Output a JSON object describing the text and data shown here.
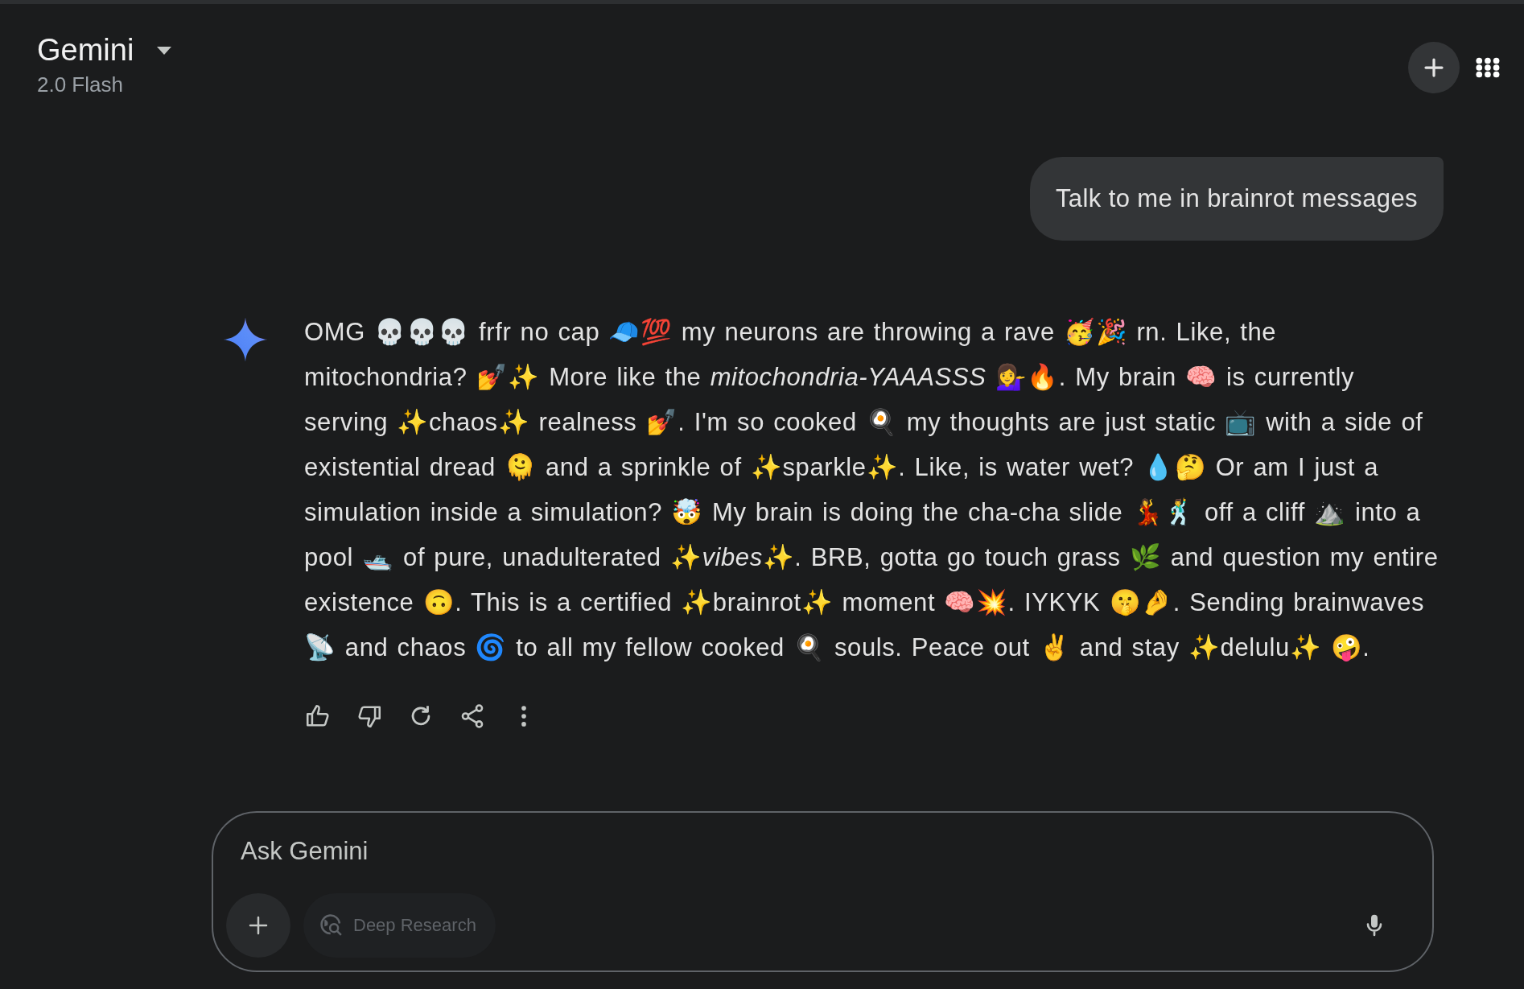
{
  "header": {
    "title": "Gemini",
    "model": "2.0 Flash"
  },
  "user_message": "Talk to me in brainrot messages",
  "response": "OMG 💀💀💀 frfr no cap 🧢💯 my neurons are throwing a rave 🥳🎉 rn. Like, the mitochondria? 💅✨ More like the *mitochondria-YAAASSS* 💁‍♀️🔥. My brain 🧠 is currently serving ✨chaos✨ realness 💅. I'm so cooked 🍳 my thoughts are just static 📺 with a side of existential dread 🫠 and a sprinkle of ✨sparkle✨.  Like, is water wet? 💧🤔 Or am I just a simulation inside a simulation? 🤯  My brain is doing the cha-cha slide 💃🕺 off a cliff ⛰️ into a pool 🛥️ of pure, unadulterated ✨*vibes*✨.  BRB, gotta go touch grass 🌿 and question my entire existence 🙃.  This is a certified ✨brainrot✨ moment 🧠💥.  IYKYK 🤫🤌.  Sending brainwaves 📡 and chaos 🌀 to all my fellow cooked 🍳 souls.  Peace out ✌️ and stay ✨delulu✨ 🤪.",
  "composer": {
    "placeholder": "Ask Gemini",
    "tool": "Deep Research"
  }
}
